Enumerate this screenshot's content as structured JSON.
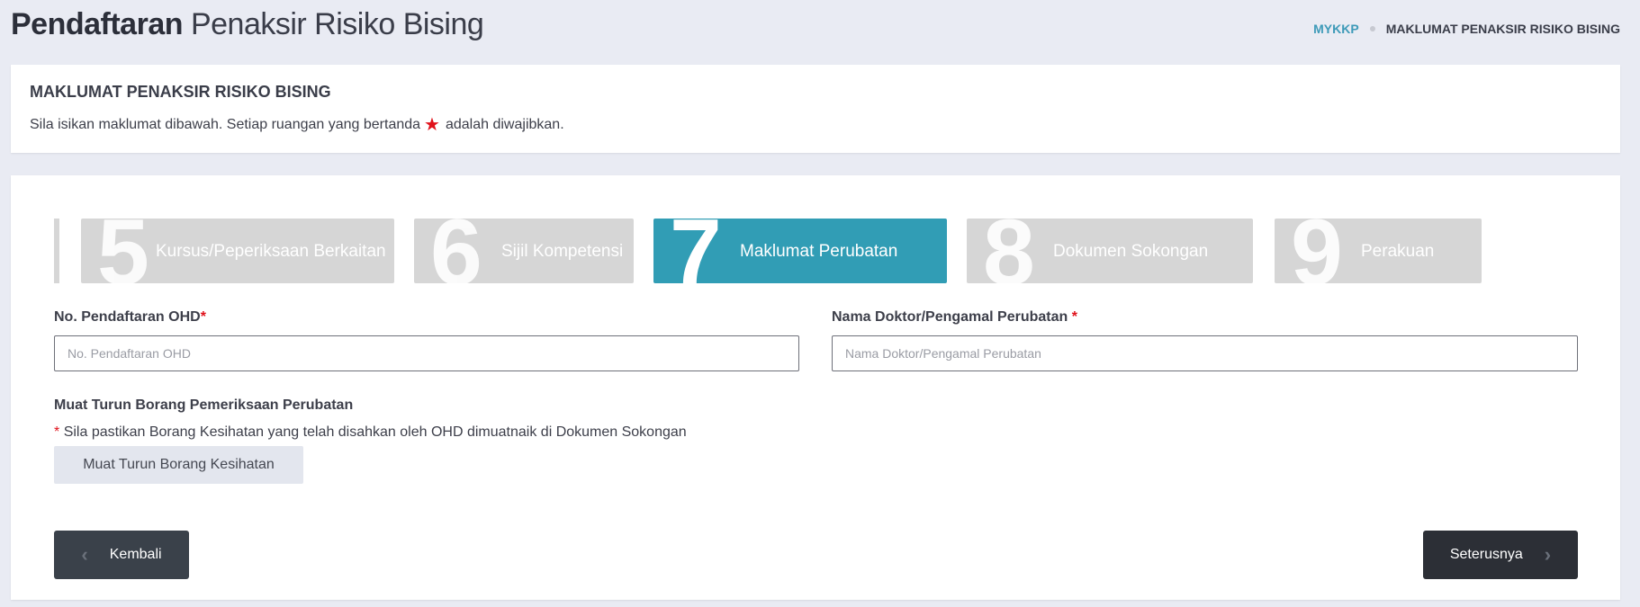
{
  "header": {
    "title_bold": "Pendaftaran",
    "title_light": "Penaksir Risiko Bising",
    "breadcrumb": {
      "root": "MYKKP",
      "current": "MAKLUMAT PENAKSIR RISIKO BISING"
    }
  },
  "info": {
    "title": "MAKLUMAT PENAKSIR RISIKO BISING",
    "desc_before": "Sila isikan maklumat dibawah. Setiap ruangan yang bertanda",
    "desc_after": "adalah diwajibkan.",
    "star_icon": "★"
  },
  "steps": [
    {
      "number": "5",
      "label": "Kursus/Peperiksaan Berkaitan",
      "active": false
    },
    {
      "number": "6",
      "label": "Sijil Kompetensi",
      "active": false
    },
    {
      "number": "7",
      "label": "Maklumat Perubatan",
      "active": true
    },
    {
      "number": "8",
      "label": "Dokumen Sokongan",
      "active": false
    },
    {
      "number": "9",
      "label": "Perakuan",
      "active": false
    }
  ],
  "form": {
    "ohd": {
      "label": "No. Pendaftaran OHD",
      "required_mark": "*",
      "placeholder": "No. Pendaftaran OHD",
      "value": ""
    },
    "doctor": {
      "label": "Nama Doktor/Pengamal Perubatan",
      "required_mark": "*",
      "placeholder": "Nama Doktor/Pengamal Perubatan",
      "value": ""
    },
    "download": {
      "title": "Muat Turun Borang Pemeriksaan Perubatan",
      "note_mark": "*",
      "note": "Sila pastikan Borang Kesihatan yang telah disahkan oleh OHD dimuatnaik di Dokumen Sokongan",
      "button": "Muat Turun Borang Kesihatan"
    }
  },
  "nav": {
    "back": "Kembali",
    "next": "Seterusnya",
    "back_icon": "‹",
    "next_icon": "›"
  },
  "colors": {
    "accent": "#319db5",
    "step_inactive": "#d6d6d6",
    "required": "#e0121b",
    "btn_dark": "#2c2f36"
  }
}
